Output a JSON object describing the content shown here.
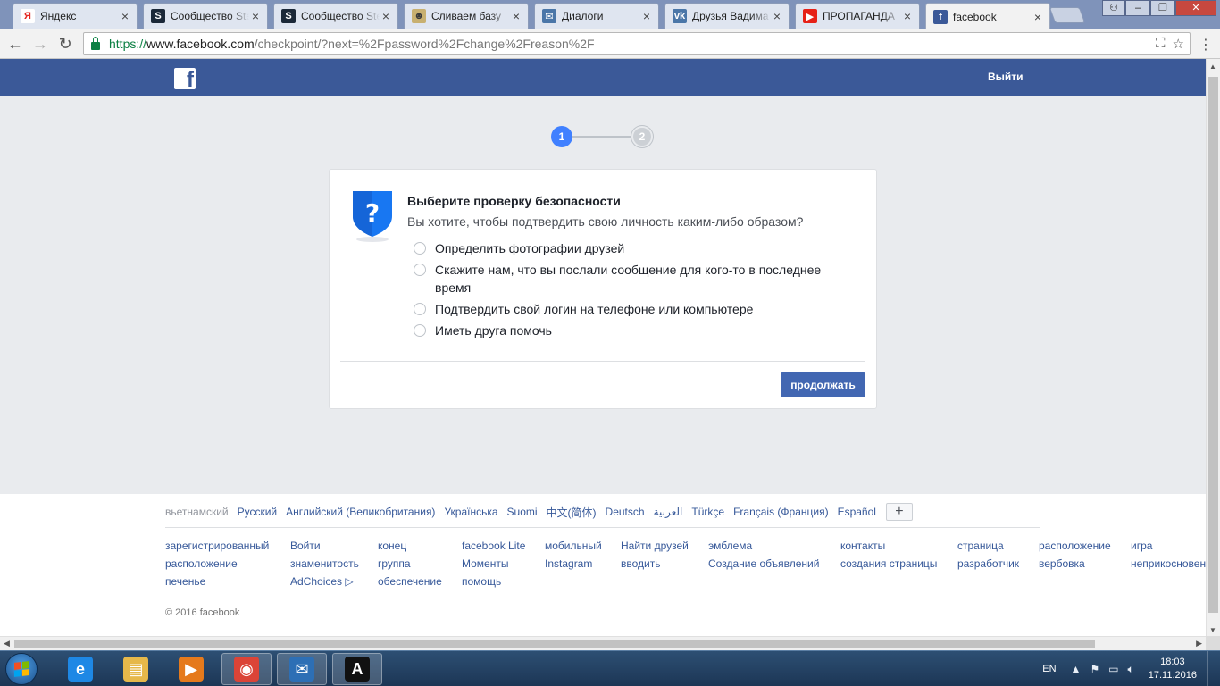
{
  "browser": {
    "tabs": [
      {
        "title": "Яндекс",
        "favicon": "Я",
        "favicon_color": "#e52620",
        "favicon_bg": "#ffffff",
        "active": false
      },
      {
        "title": "Сообщество Steam",
        "favicon": "S",
        "favicon_color": "#ffffff",
        "favicon_bg": "#1b2838",
        "active": false
      },
      {
        "title": "Сообщество Steam",
        "favicon": "S",
        "favicon_color": "#ffffff",
        "favicon_bg": "#1b2838",
        "active": false
      },
      {
        "title": "Сливаем базу",
        "favicon": "☻",
        "favicon_color": "#3a3a3a",
        "favicon_bg": "#c8b070",
        "active": false
      },
      {
        "title": "Диалоги",
        "favicon": "✉",
        "favicon_color": "#ffffff",
        "favicon_bg": "#4a76a8",
        "active": false
      },
      {
        "title": "Друзья Вадима",
        "favicon": "vk",
        "favicon_color": "#ffffff",
        "favicon_bg": "#4a76a8",
        "active": false
      },
      {
        "title": "ПРОПАГАНДА",
        "favicon": "▶",
        "favicon_color": "#ffffff",
        "favicon_bg": "#e62117",
        "active": false
      },
      {
        "title": "facebook",
        "favicon": "f",
        "favicon_color": "#ffffff",
        "favicon_bg": "#3b5998",
        "active": true
      }
    ],
    "close_glyph": "×",
    "window": {
      "user": "⚇",
      "minimize": "–",
      "maximize": "❐",
      "close": "✕"
    },
    "nav": {
      "back": "←",
      "forward": "→",
      "reload": "↻"
    },
    "url": {
      "scheme": "https://",
      "host": "www.facebook.com",
      "path": "/checkpoint/?next=%2Fpassword%2Fchange%2Freason%2F"
    },
    "omnibox_icons": {
      "translate": "⛶",
      "bookmark": "☆"
    },
    "menu": "⋮"
  },
  "header": {
    "logo": "f",
    "logout": "Выйти"
  },
  "stepper": {
    "step1": "1",
    "step2": "2",
    "current": 1
  },
  "checkpoint": {
    "title": "Выберите проверку безопасности",
    "subtitle": "Вы хотите, чтобы подтвердить свою личность каким-либо образом?",
    "options": [
      "Определить фотографии друзей",
      "Скажите нам, что вы послали сообщение для кого-то в последнее время",
      "Подтвердить свой логин на телефоне или компьютере",
      "Иметь друга помочь"
    ],
    "continue_label": "продолжать"
  },
  "footer": {
    "languages": [
      "вьетнамский",
      "Русский",
      "Английский (Великобритания)",
      "Українська",
      "Suomi",
      "中文(简体)",
      "Deutsch",
      "العربية",
      "Türkçe",
      "Français (Франция)",
      "Español"
    ],
    "current_language": "вьетнамский",
    "more_languages": "+",
    "link_columns": [
      [
        "зарегистрированный",
        "расположение",
        "печенье"
      ],
      [
        "Войти",
        "знаменитость",
        "AdChoices ▷"
      ],
      [
        "конец",
        "группа",
        "обеспечение"
      ],
      [
        "facebook Lite",
        "Моменты",
        "помощь"
      ],
      [
        "мобильный",
        "Instagram"
      ],
      [
        "Найти друзей",
        "вводить"
      ],
      [
        "эмблема",
        "Создание объявлений"
      ],
      [
        "контакты",
        "создания страницы"
      ],
      [
        "страница",
        "разработчик"
      ],
      [
        "расположение",
        "вербовка"
      ],
      [
        "игра",
        "неприкосновенность"
      ]
    ],
    "copyright": "© 2016 facebook"
  },
  "taskbar": {
    "items": [
      {
        "name": "ie-icon",
        "glyph": "e",
        "bg": "#1e88e5",
        "active": false
      },
      {
        "name": "explorer-icon",
        "glyph": "▤",
        "bg": "#e6b84a",
        "active": false
      },
      {
        "name": "media-player-icon",
        "glyph": "▶",
        "bg": "#e57a1c",
        "active": false
      },
      {
        "name": "chrome-icon",
        "glyph": "◉",
        "bg": "#db4437",
        "active": true
      },
      {
        "name": "thunderbird-icon",
        "glyph": "✉",
        "bg": "#2d6fb5",
        "active": true
      },
      {
        "name": "app-a-icon",
        "glyph": "A",
        "bg": "#111111",
        "active": true
      }
    ],
    "language": "EN",
    "time": "18:03",
    "date": "17.11.2016"
  },
  "colors": {
    "fb_blue": "#3b5998",
    "step_active": "#4080ff",
    "button": "#4267b2",
    "link": "#365899",
    "page_bg": "#e9ebee"
  }
}
